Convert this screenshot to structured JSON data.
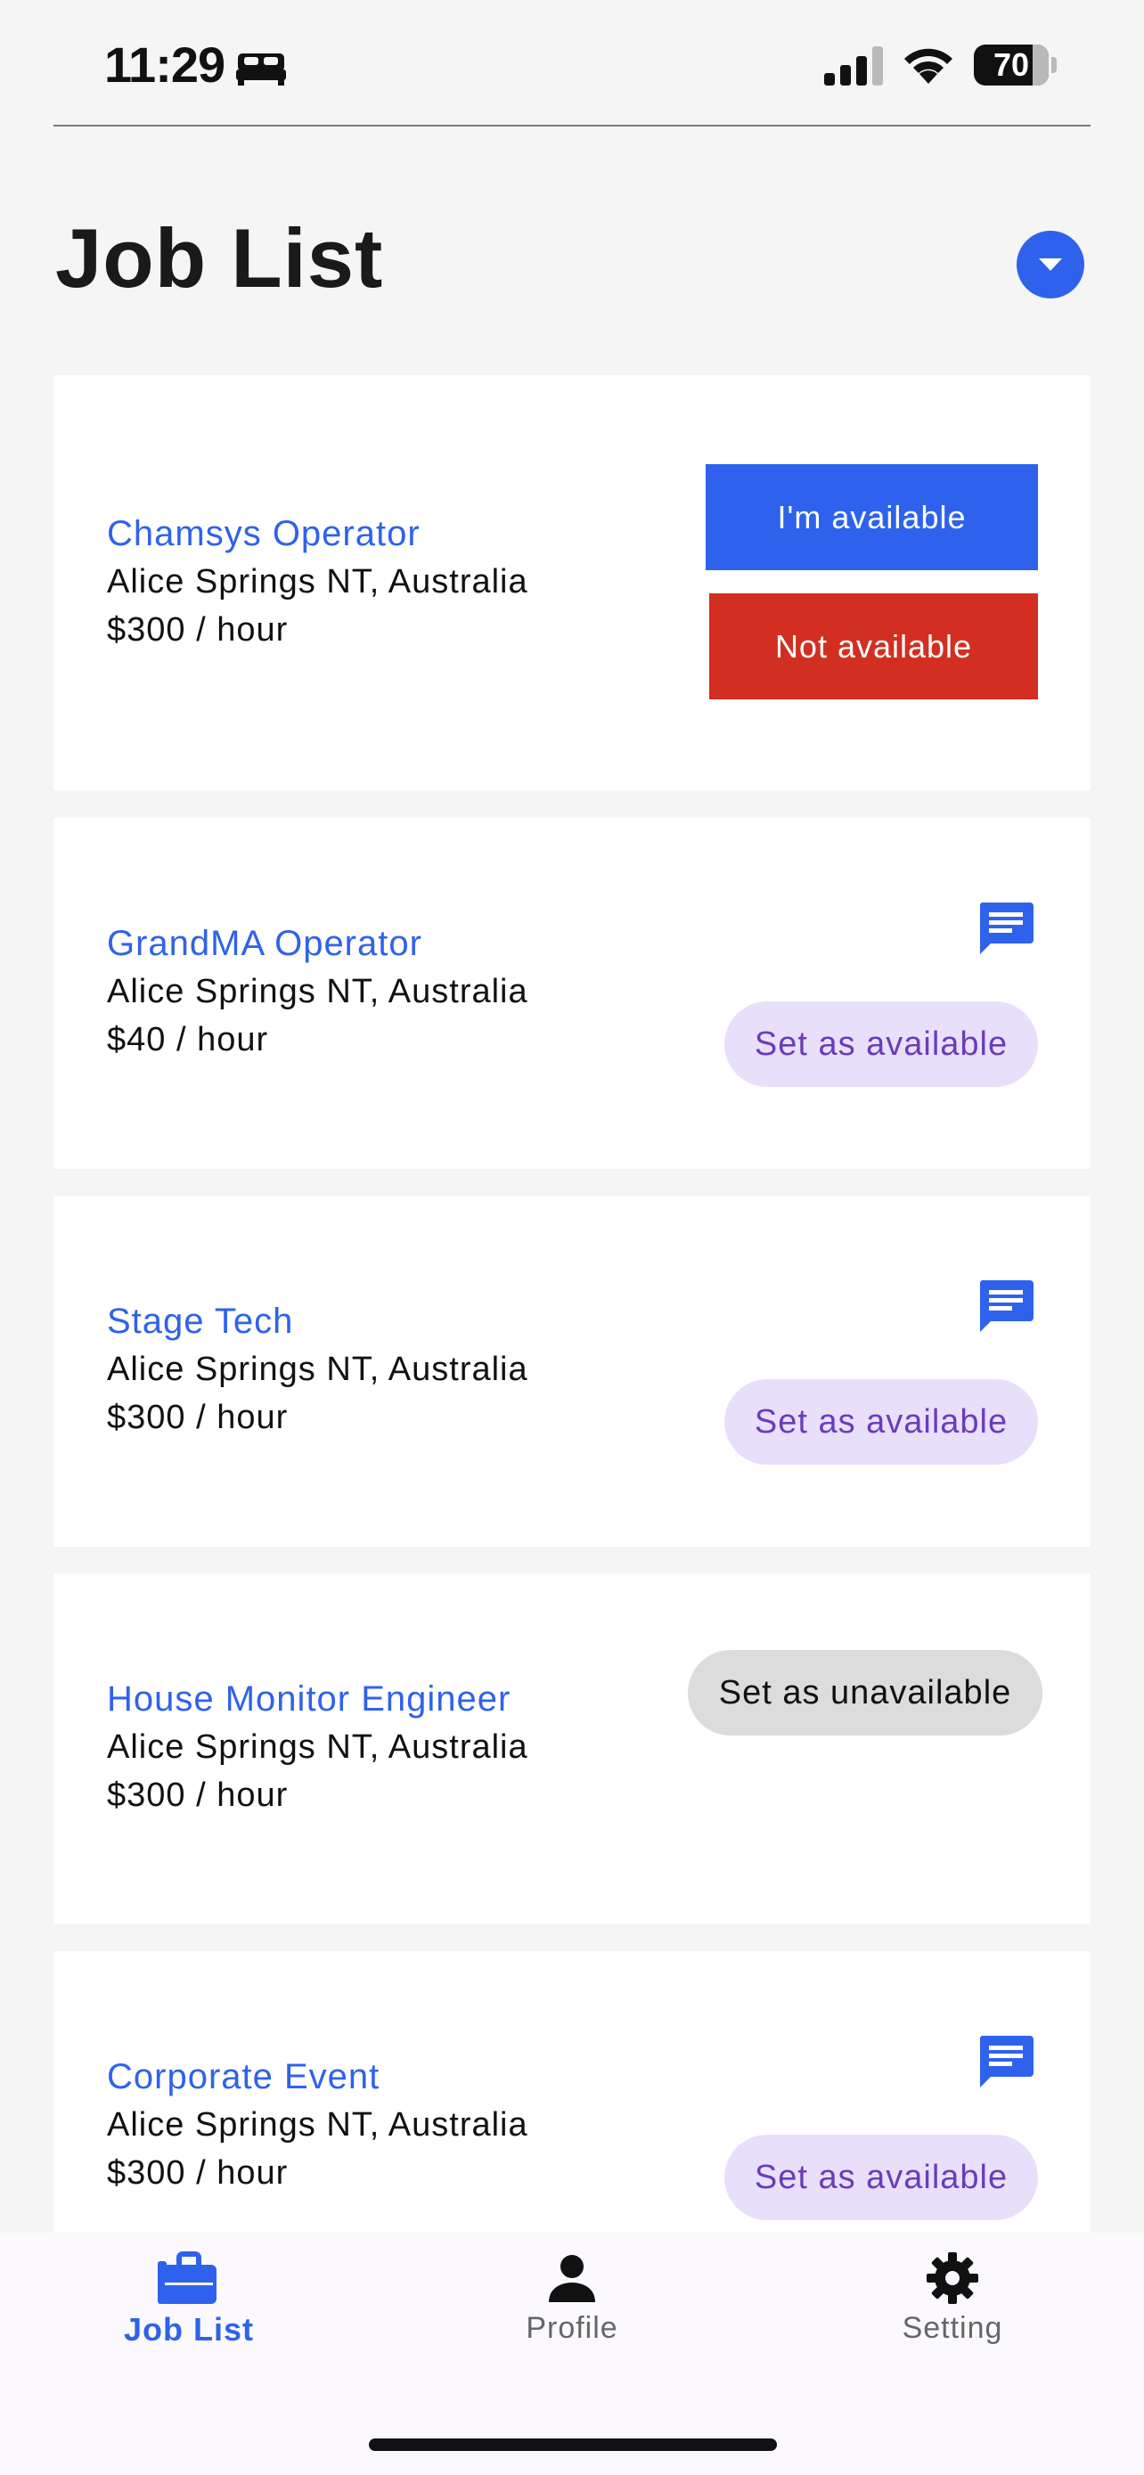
{
  "status_bar": {
    "time": "11:29",
    "battery": "70"
  },
  "header": {
    "title": "Job List"
  },
  "jobs": [
    {
      "title": "Chamsys Operator",
      "location": "Alice Springs NT, Australia",
      "rate": "$300 / hour",
      "primary_action": "I'm available",
      "secondary_action": "Not available"
    },
    {
      "title": "GrandMA Operator",
      "location": "Alice Springs NT, Australia",
      "rate": "$40 / hour",
      "action": "Set as available"
    },
    {
      "title": "Stage Tech",
      "location": "Alice Springs NT, Australia",
      "rate": "$300 / hour",
      "action": "Set as available"
    },
    {
      "title": "House Monitor Engineer",
      "location": "Alice Springs NT, Australia",
      "rate": "$300 / hour",
      "action": "Set as unavailable"
    },
    {
      "title": "Corporate Event",
      "location": "Alice Springs NT, Australia",
      "rate": "$300 / hour",
      "action": "Set as available"
    }
  ],
  "tabs": [
    {
      "label": "Job List",
      "icon": "briefcase-icon",
      "active": true
    },
    {
      "label": "Profile",
      "icon": "person-icon",
      "active": false
    },
    {
      "label": "Setting",
      "icon": "gear-icon",
      "active": false
    }
  ],
  "colors": {
    "accent": "#2f62ec",
    "danger": "#d22f22",
    "pill_bg": "#e8e0fb",
    "pill_text": "#6a3db8",
    "pill_grey": "#dcdcdc",
    "inactive_tab": "#666666"
  }
}
